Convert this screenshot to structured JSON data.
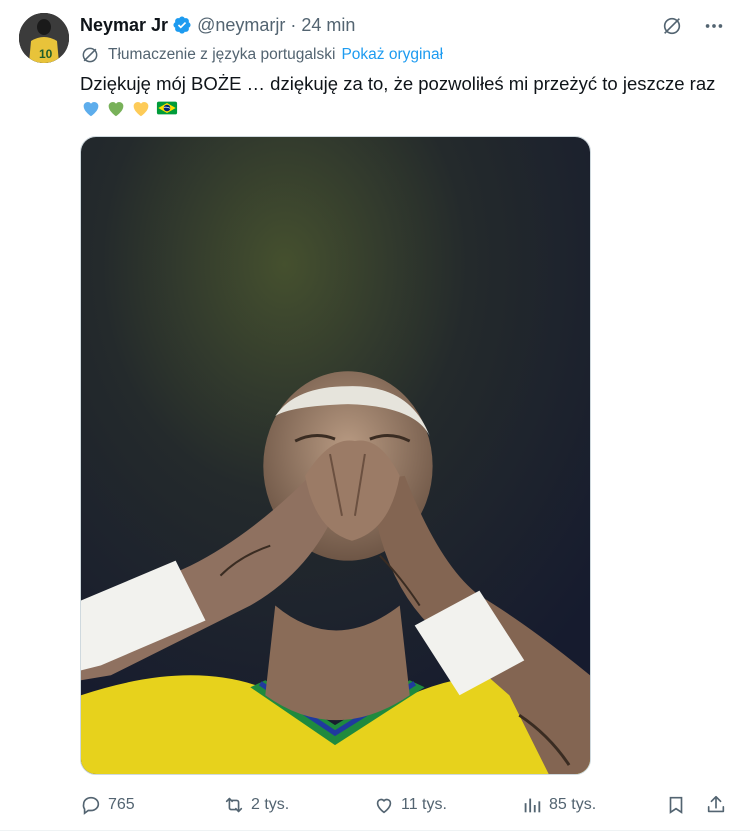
{
  "author": {
    "name": "Neymar Jr",
    "handle": "@neymarjr",
    "separator": "·",
    "time": "24 min",
    "avatar_icon": "avatar-image",
    "verified_icon": "verified-badge-icon"
  },
  "translation": {
    "label": "Tłumaczenie z języka portugalski",
    "show_original": "Pokaż oryginał"
  },
  "tweet": {
    "text": "Dziękuję mój BOŻE … dziękuję za to, że pozwoliłeś mi przeżyć to jeszcze raz",
    "emojis": [
      "blue-heart",
      "green-heart",
      "yellow-heart",
      "brazil-flag"
    ]
  },
  "media": {
    "description_icon": "photo-player-blowing-kisses"
  },
  "actions": {
    "replies": "765",
    "retweets": "2 tys.",
    "likes": "11 tys.",
    "views": "85 tys."
  },
  "colors": {
    "accent": "#1d9bf0",
    "muted": "#536471",
    "text": "#0f1419",
    "verified": "#1d9bf0"
  }
}
